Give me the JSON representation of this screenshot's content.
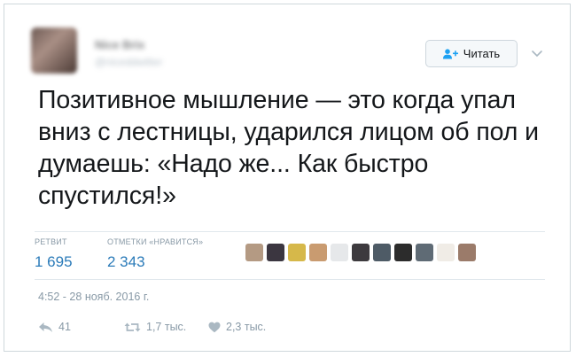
{
  "header": {
    "display_name": "Nice Brix",
    "handle": "@niceddwitter",
    "follow_label": "Читать"
  },
  "tweet": {
    "text": "Позитивное мышление — это когда упал вниз с лестницы, ударился лицом об пол и думаешь: «Надо же... Как быстро спустился!»",
    "timestamp": "4:52 - 28 нояб. 2016 г."
  },
  "stats": {
    "retweets_label": "РЕТВИТ",
    "retweets_value": "1 695",
    "likes_label": "ОТМЕТКИ «НРАВИТСЯ»",
    "likes_value": "2 343"
  },
  "likers": [
    {
      "color": "#b49a83"
    },
    {
      "color": "#3b3640"
    },
    {
      "color": "#d6b84a"
    },
    {
      "color": "#c99b70"
    },
    {
      "color": "#e6e8ea"
    },
    {
      "color": "#3d3a3e"
    },
    {
      "color": "#4e5b66"
    },
    {
      "color": "#2c2c2c"
    },
    {
      "color": "#5f6b75"
    },
    {
      "color": "#f0ece6"
    },
    {
      "color": "#9b7b6a"
    }
  ],
  "actions": {
    "reply_count": "41",
    "retweet_count": "1,7 тыс.",
    "like_count": "2,3 тыс."
  },
  "colors": {
    "link": "#2b7bb9",
    "muted": "#8899a6",
    "text": "#14171a",
    "border": "#cfd8dc"
  }
}
